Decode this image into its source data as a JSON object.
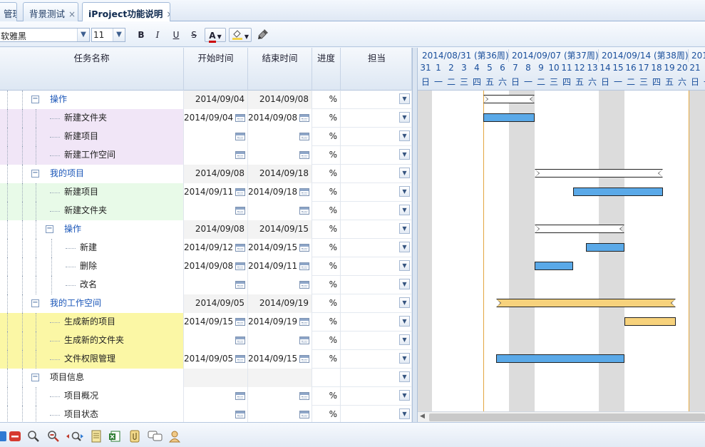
{
  "tabs": [
    {
      "label": "管理",
      "closable": false,
      "active": false
    },
    {
      "label": "背景测试",
      "closable": true,
      "active": false
    },
    {
      "label": "iProject功能说明",
      "closable": true,
      "active": true
    }
  ],
  "tab_close_glyph": "×",
  "format_toolbar": {
    "font_family": "软雅黑",
    "font_size": "11",
    "bold": "B",
    "italic": "I",
    "underline": "U",
    "strike": "S",
    "font_color": "A",
    "font_color_value": "#cc0000",
    "fill_color_value": "#f3d34a",
    "format_painter_icon": "brush-icon"
  },
  "columns": {
    "name": "任务名称",
    "start": "开始时间",
    "end": "结束时间",
    "progress": "进度",
    "owner": "担当"
  },
  "rows": [
    {
      "name": "操作",
      "level": 1,
      "group": true,
      "start": "2014/09/04",
      "end": "2014/09/08",
      "progress": "%",
      "calendar": false,
      "bg": "#ffffff"
    },
    {
      "name": "新建文件夹",
      "level": 2,
      "group": false,
      "start": "2014/09/04",
      "end": "2014/09/08",
      "progress": "%",
      "calendar": true,
      "bg": "#f1e6f7"
    },
    {
      "name": "新建项目",
      "level": 2,
      "group": false,
      "start": "",
      "end": "",
      "progress": "%",
      "calendar": true,
      "bg": "#f1e6f7"
    },
    {
      "name": "新建工作空间",
      "level": 2,
      "group": false,
      "start": "",
      "end": "",
      "progress": "%",
      "calendar": true,
      "bg": "#f1e6f7"
    },
    {
      "name": "我的项目",
      "level": 1,
      "group": true,
      "start": "2014/09/08",
      "end": "2014/09/18",
      "progress": "%",
      "calendar": false,
      "bg": "#ffffff"
    },
    {
      "name": "新建项目",
      "level": 2,
      "group": false,
      "start": "2014/09/11",
      "end": "2014/09/18",
      "progress": "%",
      "calendar": true,
      "bg": "#e8fae8"
    },
    {
      "name": "新建文件夹",
      "level": 2,
      "group": false,
      "start": "",
      "end": "",
      "progress": "%",
      "calendar": true,
      "bg": "#e8fae8"
    },
    {
      "name": "操作",
      "level": 2,
      "group": true,
      "start": "2014/09/08",
      "end": "2014/09/15",
      "progress": "%",
      "calendar": false,
      "bg": "#ffffff"
    },
    {
      "name": "新建",
      "level": 3,
      "group": false,
      "start": "2014/09/12",
      "end": "2014/09/15",
      "progress": "%",
      "calendar": true,
      "bg": "#ffffff"
    },
    {
      "name": "删除",
      "level": 3,
      "group": false,
      "start": "2014/09/08",
      "end": "2014/09/11",
      "progress": "%",
      "calendar": true,
      "bg": "#ffffff"
    },
    {
      "name": "改名",
      "level": 3,
      "group": false,
      "start": "",
      "end": "",
      "progress": "%",
      "calendar": true,
      "bg": "#ffffff"
    },
    {
      "name": "我的工作空间",
      "level": 1,
      "group": true,
      "start": "2014/09/05",
      "end": "2014/09/19",
      "progress": "%",
      "calendar": false,
      "bg": "#ffffff"
    },
    {
      "name": "生成新的项目",
      "level": 2,
      "group": false,
      "start": "2014/09/15",
      "end": "2014/09/19",
      "progress": "%",
      "calendar": true,
      "bg": "#fbf7a5"
    },
    {
      "name": "生成新的文件夹",
      "level": 2,
      "group": false,
      "start": "",
      "end": "",
      "progress": "%",
      "calendar": true,
      "bg": "#fbf7a5"
    },
    {
      "name": "文件权限管理",
      "level": 2,
      "group": false,
      "start": "2014/09/05",
      "end": "2014/09/15",
      "progress": "%",
      "calendar": true,
      "bg": "#fbf7a5"
    },
    {
      "name": "项目信息",
      "level": 1,
      "group": true,
      "plain": true,
      "start": "",
      "end": "",
      "progress": "",
      "calendar": false,
      "bg": "#ffffff"
    },
    {
      "name": "项目概况",
      "level": 2,
      "group": false,
      "start": "",
      "end": "",
      "progress": "%",
      "calendar": true,
      "bg": "#ffffff"
    },
    {
      "name": "项目状态",
      "level": 2,
      "group": false,
      "start": "",
      "end": "",
      "progress": "%",
      "calendar": true,
      "bg": "#ffffff"
    }
  ],
  "timeline": {
    "weeks": [
      "2014/08/31 (第36周)",
      "2014/09/07 (第37周)",
      "2014/09/14 (第38周)",
      "201"
    ],
    "days": [
      "31",
      "1",
      "2",
      "3",
      "4",
      "5",
      "6",
      "7",
      "8",
      "9",
      "10",
      "11",
      "12",
      "13",
      "14",
      "15",
      "16",
      "17",
      "18",
      "19",
      "20",
      "21",
      "2"
    ],
    "weekdays": [
      "日",
      "一",
      "二",
      "三",
      "四",
      "五",
      "六",
      "日",
      "一",
      "二",
      "三",
      "四",
      "五",
      "六",
      "日",
      "一",
      "二",
      "三",
      "四",
      "五",
      "六",
      "日",
      "一"
    ],
    "first_date": "2014/08/31",
    "range_lines": [
      "2014/09/04",
      "2014/09/20"
    ],
    "shaded_days": [
      "2014/09/06",
      "2014/09/13",
      "2014/09/20"
    ]
  },
  "gantt_bars": [
    {
      "row": 0,
      "start": "2014/09/04",
      "end": "2014/09/08",
      "kind": "summary"
    },
    {
      "row": 1,
      "start": "2014/09/04",
      "end": "2014/09/08",
      "kind": "task"
    },
    {
      "row": 4,
      "start": "2014/09/08",
      "end": "2014/09/18",
      "kind": "summary"
    },
    {
      "row": 5,
      "start": "2014/09/11",
      "end": "2014/09/18",
      "kind": "task"
    },
    {
      "row": 7,
      "start": "2014/09/08",
      "end": "2014/09/15",
      "kind": "summary"
    },
    {
      "row": 8,
      "start": "2014/09/12",
      "end": "2014/09/15",
      "kind": "task"
    },
    {
      "row": 9,
      "start": "2014/09/08",
      "end": "2014/09/11",
      "kind": "task"
    },
    {
      "row": 11,
      "start": "2014/09/05",
      "end": "2014/09/19",
      "kind": "summary-yellow"
    },
    {
      "row": 12,
      "start": "2014/09/15",
      "end": "2014/09/19",
      "kind": "task-yellow"
    },
    {
      "row": 14,
      "start": "2014/09/05",
      "end": "2014/09/15",
      "kind": "task"
    }
  ],
  "bottom_toolbar": [
    "save-icon",
    "delete-icon",
    "zoom-icon",
    "zoom-out-icon",
    "zoom-fit-icon",
    "notes-icon",
    "excel-export-icon",
    "attach-icon",
    "comment-icon",
    "user-icon"
  ]
}
